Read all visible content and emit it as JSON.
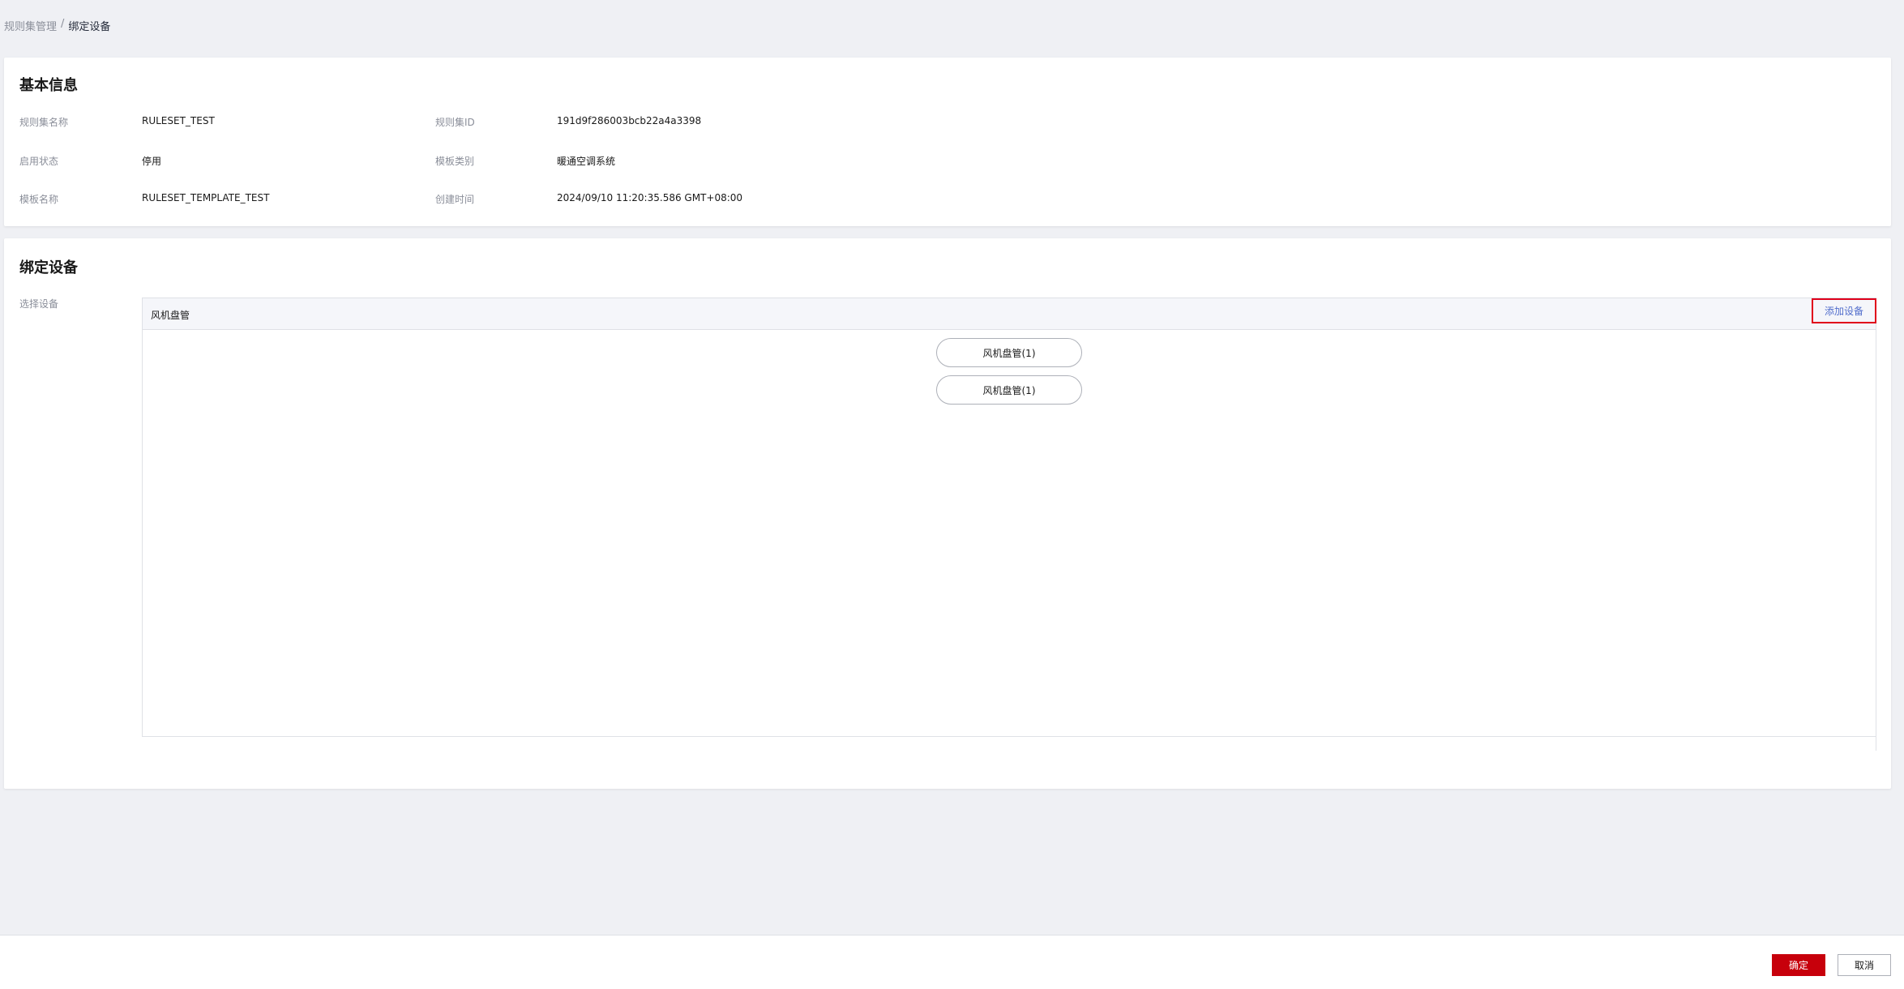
{
  "breadcrumb": {
    "parent": "规则集管理",
    "separator": "/",
    "current": "绑定设备"
  },
  "basic_info": {
    "title": "基本信息",
    "rows": [
      {
        "label1": "规则集名称",
        "value1": "RULESET_TEST",
        "label2": "规则集ID",
        "value2": "191d9f286003bcb22a4a3398"
      },
      {
        "label1": "启用状态",
        "value1": "停用",
        "label2": "模板类别",
        "value2": "暖通空调系统"
      },
      {
        "label1": "模板名称",
        "value1": "RULESET_TEMPLATE_TEST",
        "label2": "创建时间",
        "value2": "2024/09/10 11:20:35.586 GMT+08:00"
      }
    ]
  },
  "bind_devices": {
    "title": "绑定设备",
    "select_label": "选择设备",
    "panel": {
      "type_name": "风机盘管",
      "add_button": "添加设备",
      "devices": [
        "风机盘管(1)",
        "风机盘管(1)"
      ]
    }
  },
  "footer": {
    "confirm": "确定",
    "cancel": "取消"
  },
  "colors": {
    "primary": "#c7000b",
    "highlight_border": "#e0001b",
    "link": "#526ecc"
  }
}
